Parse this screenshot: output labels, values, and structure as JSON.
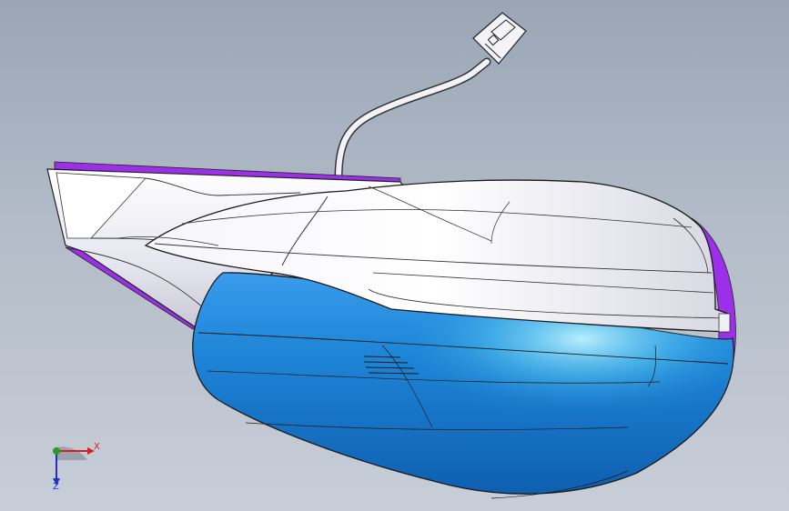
{
  "viewport": {
    "background_top": "#9aa6b6",
    "background_bottom": "#c8ced8",
    "model": {
      "housing_color": "#1f86d8",
      "shell_color": "#f2f2f8",
      "trim_color": "#9b30e8",
      "edge_color": "#222222"
    }
  },
  "triad": {
    "x_label": "X",
    "y_label": "",
    "z_label": "Z",
    "x_color": "#d42020",
    "y_color": "#20a020",
    "z_color": "#2030c8"
  }
}
